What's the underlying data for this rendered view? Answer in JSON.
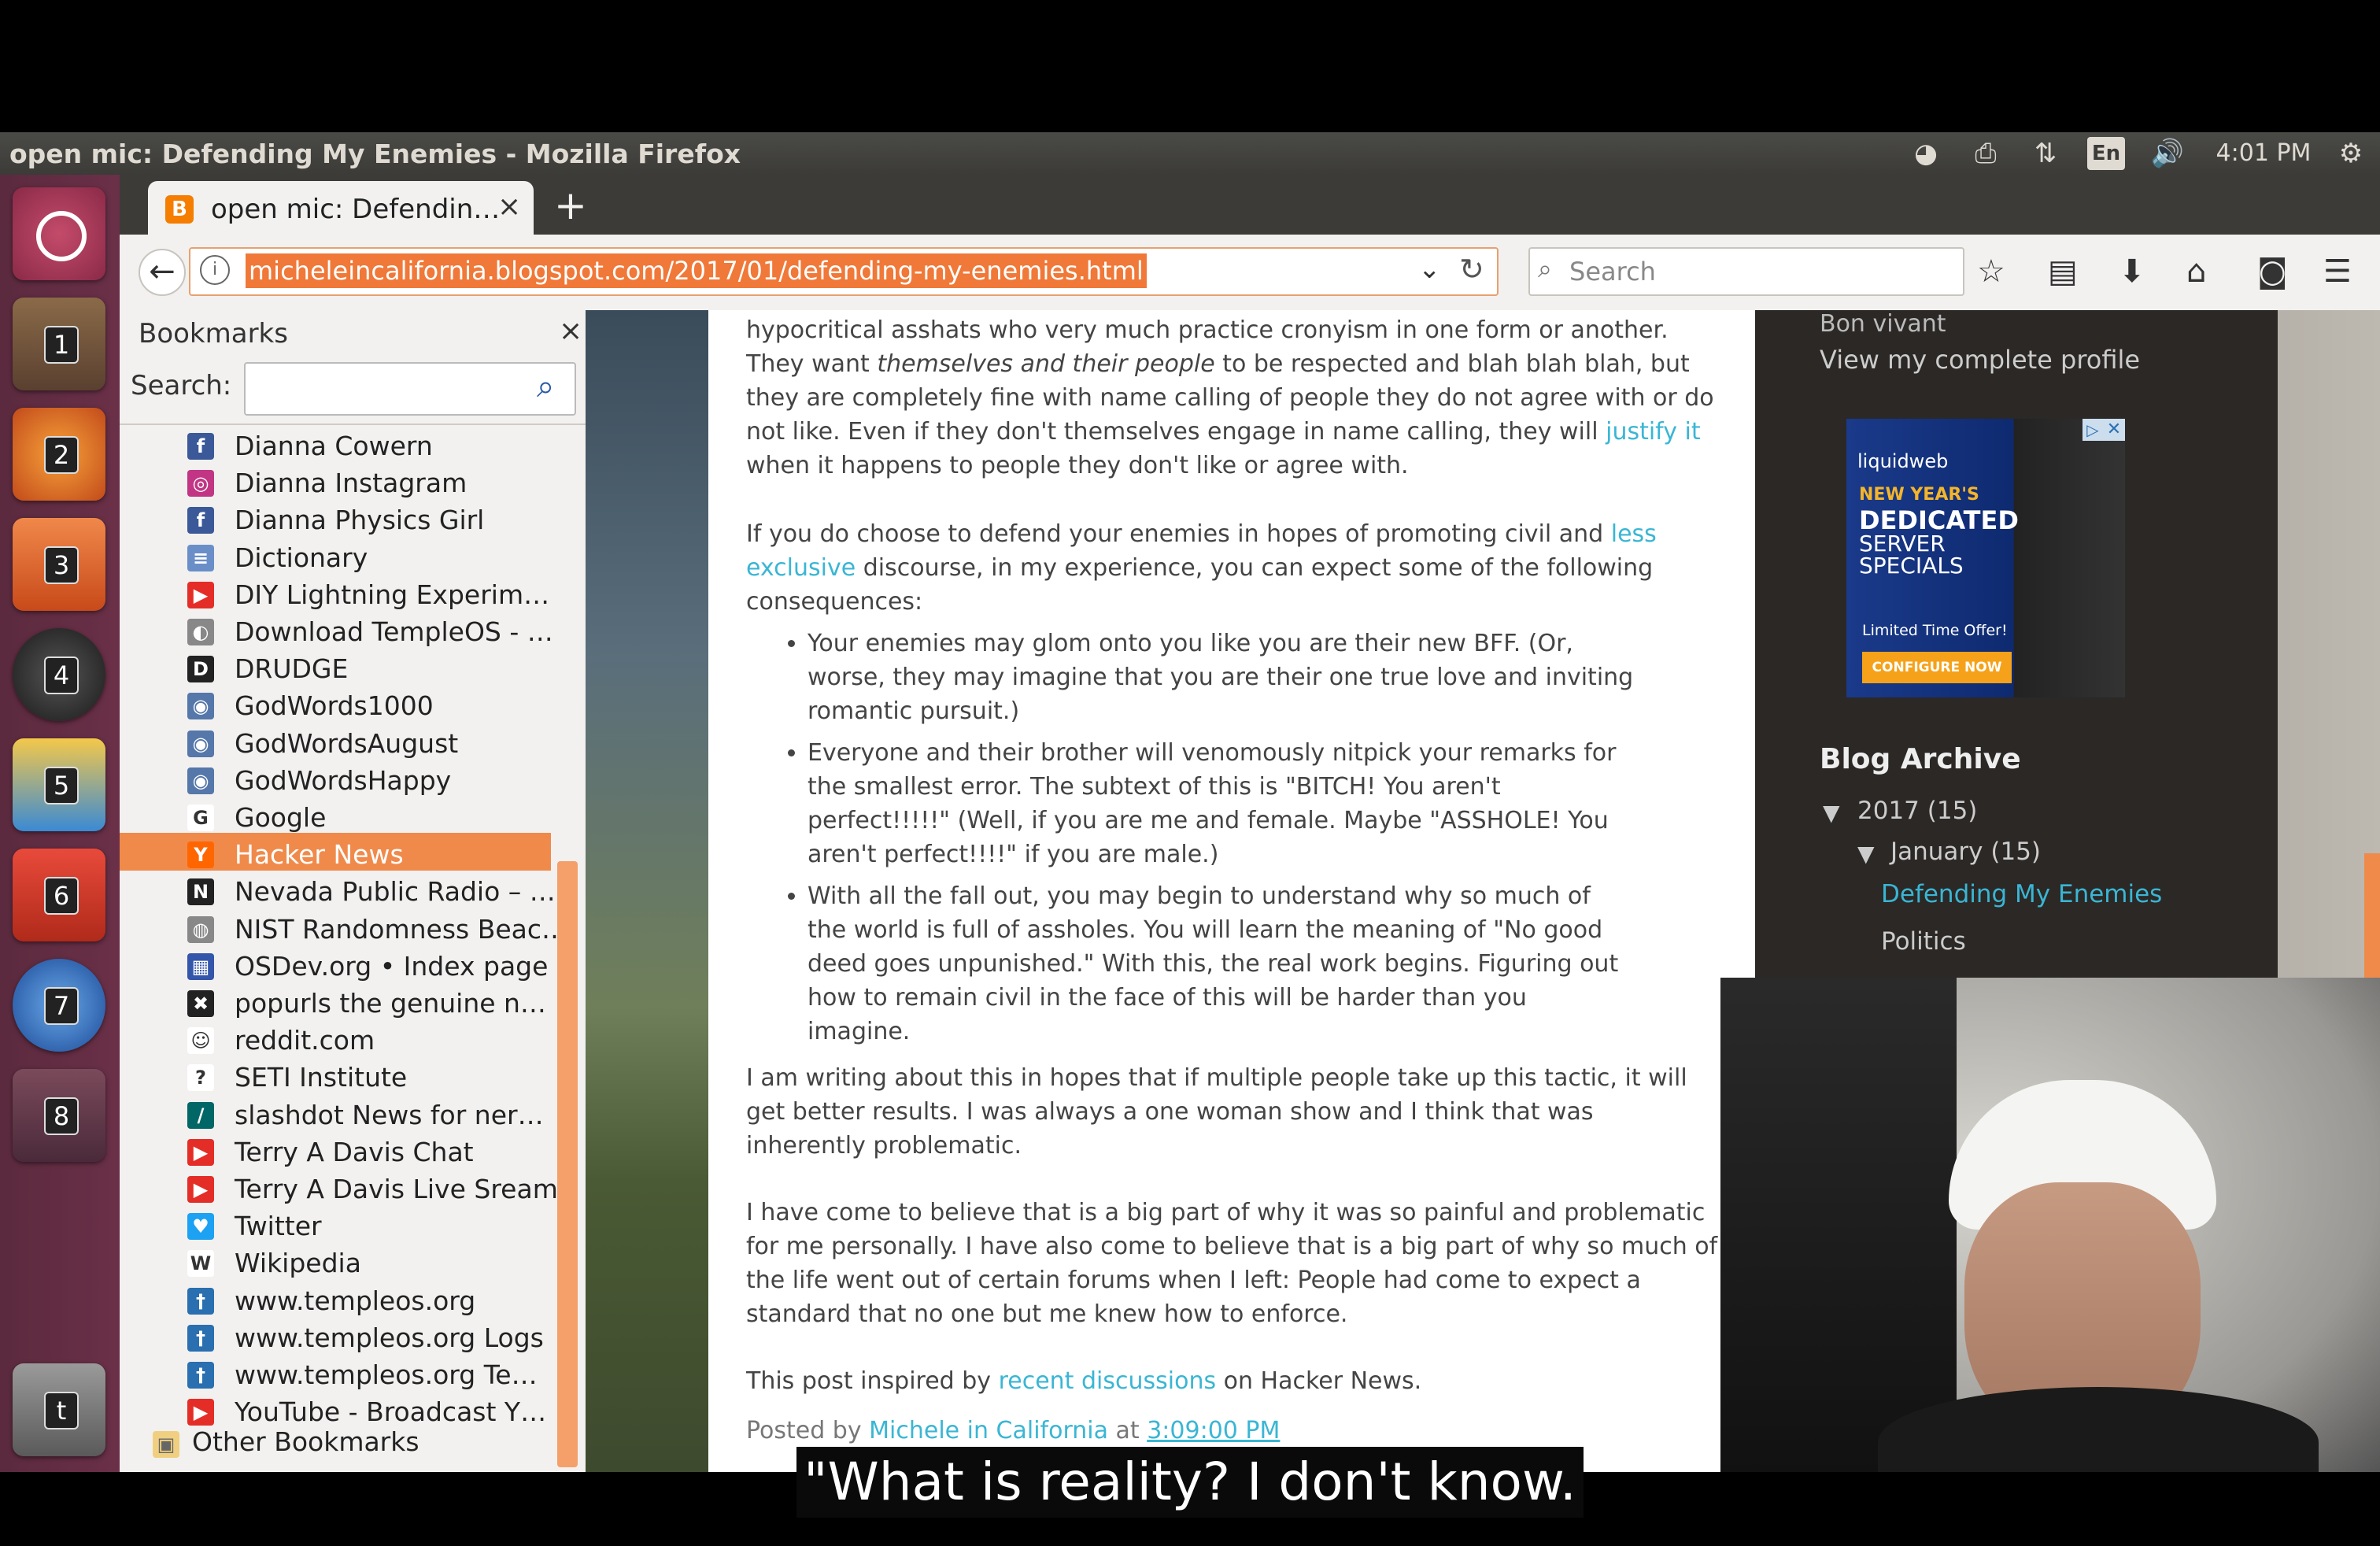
{
  "window": {
    "title": "open mic: Defending My Enemies - Mozilla Firefox"
  },
  "tray": {
    "language": "En",
    "time": "4:01 PM"
  },
  "launcher": {
    "items": [
      "1",
      "2",
      "3",
      "4",
      "5",
      "6",
      "7",
      "8"
    ],
    "trash_label": "t"
  },
  "tab": {
    "label": "open mic: Defendin…",
    "close": "×",
    "new_tab": "+"
  },
  "navbar": {
    "url": "micheleincalifornia.blogspot.com/2017/01/defending-my-enemies.html",
    "search_placeholder": "Search"
  },
  "bookmarks": {
    "title": "Bookmarks",
    "close": "×",
    "search_label": "Search:",
    "items": [
      {
        "label": "Dianna Cowern",
        "icon": "facebook-icon",
        "color": "#3b5998",
        "glyph": "f"
      },
      {
        "label": "Dianna Instagram",
        "icon": "instagram-icon",
        "color": "#c13584",
        "glyph": "◎"
      },
      {
        "label": "Dianna Physics Girl",
        "icon": "facebook-icon",
        "color": "#3b5998",
        "glyph": "f"
      },
      {
        "label": "Dictionary",
        "icon": "dictionary-icon",
        "color": "#6a8fc8",
        "glyph": "≡"
      },
      {
        "label": "DIY Lightning Experim…",
        "icon": "youtube-icon",
        "color": "#e52d27",
        "glyph": "▶"
      },
      {
        "label": "Download TempleOS - …",
        "icon": "templeos-icon",
        "color": "#888",
        "glyph": "◐"
      },
      {
        "label": "DRUDGE",
        "icon": "drudge-icon",
        "color": "#222",
        "glyph": "D"
      },
      {
        "label": "GodWords1000",
        "icon": "godwords-icon",
        "color": "#5577aa",
        "glyph": "◉"
      },
      {
        "label": "GodWordsAugust",
        "icon": "godwords-icon",
        "color": "#5577aa",
        "glyph": "◉"
      },
      {
        "label": "GodWordsHappy",
        "icon": "godwords-icon",
        "color": "#5577aa",
        "glyph": "◉"
      },
      {
        "label": "Google",
        "icon": "google-icon",
        "color": "#ffffff",
        "glyph": "G"
      },
      {
        "label": "Hacker News",
        "icon": "hackernews-icon",
        "color": "#ff6600",
        "glyph": "Y"
      },
      {
        "label": "Nevada Public Radio – …",
        "icon": "npr-icon",
        "color": "#222",
        "glyph": "N"
      },
      {
        "label": "NIST Randomness Beac…",
        "icon": "nist-icon",
        "color": "#888",
        "glyph": "◍"
      },
      {
        "label": "OSDev.org • Index page",
        "icon": "osdev-icon",
        "color": "#3355aa",
        "glyph": "▦"
      },
      {
        "label": "popurls  the genuine n…",
        "icon": "popurls-icon",
        "color": "#222",
        "glyph": "✖"
      },
      {
        "label": "reddit.com",
        "icon": "reddit-icon",
        "color": "#ffffff",
        "glyph": "☺"
      },
      {
        "label": "SETI Institute",
        "icon": "seti-icon",
        "color": "#ffffff",
        "glyph": "?"
      },
      {
        "label": "slashdot News for ner…",
        "icon": "slashdot-icon",
        "color": "#006666",
        "glyph": "/"
      },
      {
        "label": "Terry A Davis Chat",
        "icon": "youtube-icon",
        "color": "#e52d27",
        "glyph": "▶"
      },
      {
        "label": "Terry A Davis Live Sream",
        "icon": "youtube-icon",
        "color": "#e52d27",
        "glyph": "▶"
      },
      {
        "label": "Twitter",
        "icon": "twitter-icon",
        "color": "#1da1f2",
        "glyph": "♥"
      },
      {
        "label": "Wikipedia",
        "icon": "wikipedia-icon",
        "color": "#ffffff",
        "glyph": "W"
      },
      {
        "label": "www.templeos.org",
        "icon": "templeos-icon",
        "color": "#2a6fb0",
        "glyph": "†"
      },
      {
        "label": "www.templeos.org  Logs",
        "icon": "templeos-icon",
        "color": "#2a6fb0",
        "glyph": "†"
      },
      {
        "label": "www.templeos.org  Te…",
        "icon": "templeos-icon",
        "color": "#2a6fb0",
        "glyph": "†"
      },
      {
        "label": "YouTube - Broadcast Y…",
        "icon": "youtube-icon",
        "color": "#e52d27",
        "glyph": "▶"
      }
    ],
    "other": "Other Bookmarks"
  },
  "post": {
    "p1a": "hypocritical asshats who very much practice cronyism in one form or another. They want ",
    "p1em": "themselves and their people",
    "p1b": " to be respected and blah blah blah, but they are completely fine with name calling of people they do not agree with or do not like. Even if they don't themselves engage in name calling, they will ",
    "p1link": "justify it",
    "p1c": " when it happens to people they don't like or agree with.",
    "p2a": "If you do choose to defend your enemies in hopes of promoting civil and ",
    "p2link": "less exclusive",
    "p2b": " discourse, in my experience, you can expect some of the following consequences:",
    "bullets": [
      "Your enemies may glom onto you like you are their new BFF. (Or, worse, they may imagine that you are their one true love and inviting romantic pursuit.)",
      "Everyone and their brother will venomously nitpick your remarks for the smallest error. The subtext of this is \"BITCH! You aren't perfect!!!!!\" (Well, if you are me and female. Maybe \"ASSHOLE! You aren't perfect!!!!\" if you are male.)",
      "With all the fall out, you may begin to understand why so much of the world is full of assholes. You will learn the meaning of \"No good deed goes unpunished.\" With this, the real work begins. Figuring out how to remain civil in the face of this will be harder than you imagine."
    ],
    "p3": "I am writing about this in hopes that if multiple people take up this tactic, it will get better results. I was always a one woman show and I think that was inherently problematic.",
    "p4": "I have come to believe that is a big part of why it was so painful and problematic for me personally. I have also come to believe that is a big part of why so much of the life went out of certain forums when I left: People had come to expect a standard that no one but me knew how to enforce.",
    "p5a": "This post inspired by ",
    "p5link": "recent discussions",
    "p5b": " on Hacker News.",
    "posted_by": "Posted by ",
    "author": "Michele in California",
    "at": " at ",
    "time": "3:09:00 PM"
  },
  "sidebar_right": {
    "bon_vivant": "Bon vivant",
    "profile_link": "View my complete profile",
    "ad": {
      "brand": "liquidweb",
      "line1": "NEW YEAR'S",
      "line2": "DEDICATED",
      "line3": "SERVER",
      "line4": "SPECIALS",
      "offer": "Limited Time Offer!",
      "cta": "CONFIGURE NOW"
    },
    "archive_title": "Blog Archive",
    "year": "2017 (15)",
    "month": "January (15)",
    "current_post": "Defending My Enemies",
    "next_post": "Politics"
  },
  "subtitle": "\"What is reality? I don't know."
}
